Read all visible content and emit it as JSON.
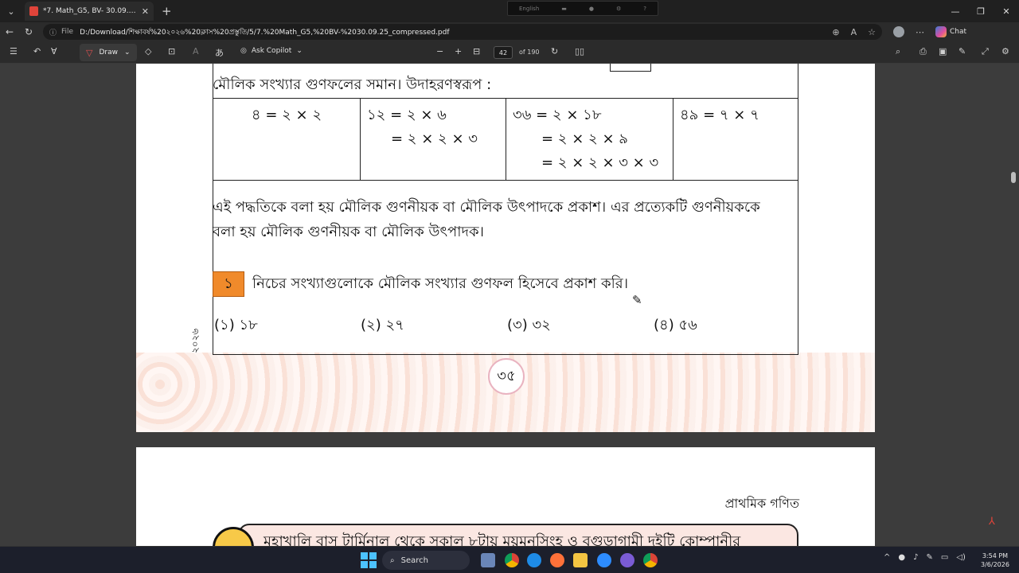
{
  "browser": {
    "tab_title": "*7. Math_G5, BV- 30.09.25_compressed.pdf",
    "tab_close": "✕",
    "new_tab": "+",
    "lang_indicator": "English",
    "file_label": "File",
    "url": "D:/Download/শিক্ষাবর্ষ%20২০২৬%20ক্লাস%20প্রস্তুতি/5/7.%20Math_G5,%20BV-%2030.09.25_compressed.pdf",
    "chat_label": "Chat"
  },
  "pdf_toolbar": {
    "draw_label": "Draw",
    "ask_copilot_label": "Ask Copilot",
    "page_current": "42",
    "page_total": "of 190"
  },
  "page1": {
    "intro": "মৌলিক সংখ্যার গুণফলের সমান। উদাহরণস্বরূপ :",
    "table": {
      "col1": [
        "৪ = ২ × ২"
      ],
      "col2": [
        "১২  = ২ × ৬",
        "= ২ × ২ × ৩"
      ],
      "col3": [
        "৩৬  = ২ × ১৮",
        "= ২ × ২ × ৯",
        "= ২ × ২ × ৩ × ৩"
      ],
      "col4": [
        "৪৯ = ৭ × ৭"
      ]
    },
    "explain_line1": "এই পদ্ধতিকে বলা হয় মৌলিক গুণনীয়ক বা মৌলিক উৎপাদকে প্রকাশ। এর প্রত্যেকটি গুণনীয়ককে",
    "explain_line2": "বলা হয় মৌলিক গুণনীয়ক বা মৌলিক উৎপাদক।",
    "exercise_number": "১",
    "exercise_text": "নিচের সংখ্যাগুলোকে মৌলিক সংখ্যার গুণফল হিসেবে প্রকাশ করি।",
    "problems": [
      "(১) ১৮",
      "(২) ২৭",
      "(৩) ৩২",
      "(৪) ৫৬"
    ],
    "side_year": "২০২৬",
    "page_number": "৩৫"
  },
  "page2": {
    "header": "প্রাথমিক গণিত",
    "problem_text": "মহাখালি বাস টার্মিনাল থেকে সকাল ৮টায় ময়মনসিংহ ও বগুড়াগামী দুইটি কোম্পানীর"
  },
  "taskbar": {
    "search_placeholder": "Search",
    "time": "3:54 PM",
    "date": "3/6/2026"
  }
}
